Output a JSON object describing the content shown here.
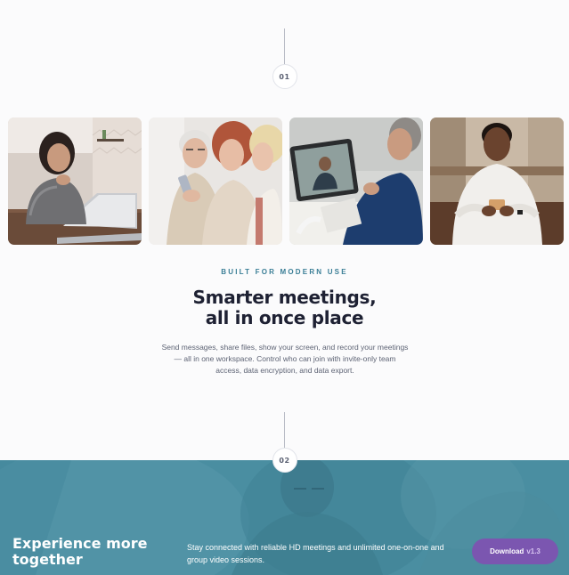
{
  "steps": {
    "first": "01",
    "second": "02"
  },
  "photos": [
    {
      "alt": "Woman smiling at laptop in kitchen"
    },
    {
      "alt": "Three women looking at a phone"
    },
    {
      "alt": "Man on a video call with a tablet"
    },
    {
      "alt": "Man smiling while using a phone"
    }
  ],
  "section": {
    "kicker": "BUILT FOR MODERN USE",
    "headline_line1": "Smarter meetings,",
    "headline_line2": "all in once place",
    "body": "Send messages, share files, show your screen, and record your meetings — all in one workspace. Control who can join with invite-only team access, data encryption, and data export."
  },
  "banner": {
    "title": "Experience more together",
    "text": "Stay connected with reliable HD meetings and unlimited one-on-one and group video sessions.",
    "button_label": "Download",
    "button_version": "v1.3"
  },
  "colors": {
    "accent_teal": "#3a7e96",
    "banner_bg": "#4a8ea1",
    "button_purple": "#7b56b0",
    "headline": "#1e2133"
  }
}
